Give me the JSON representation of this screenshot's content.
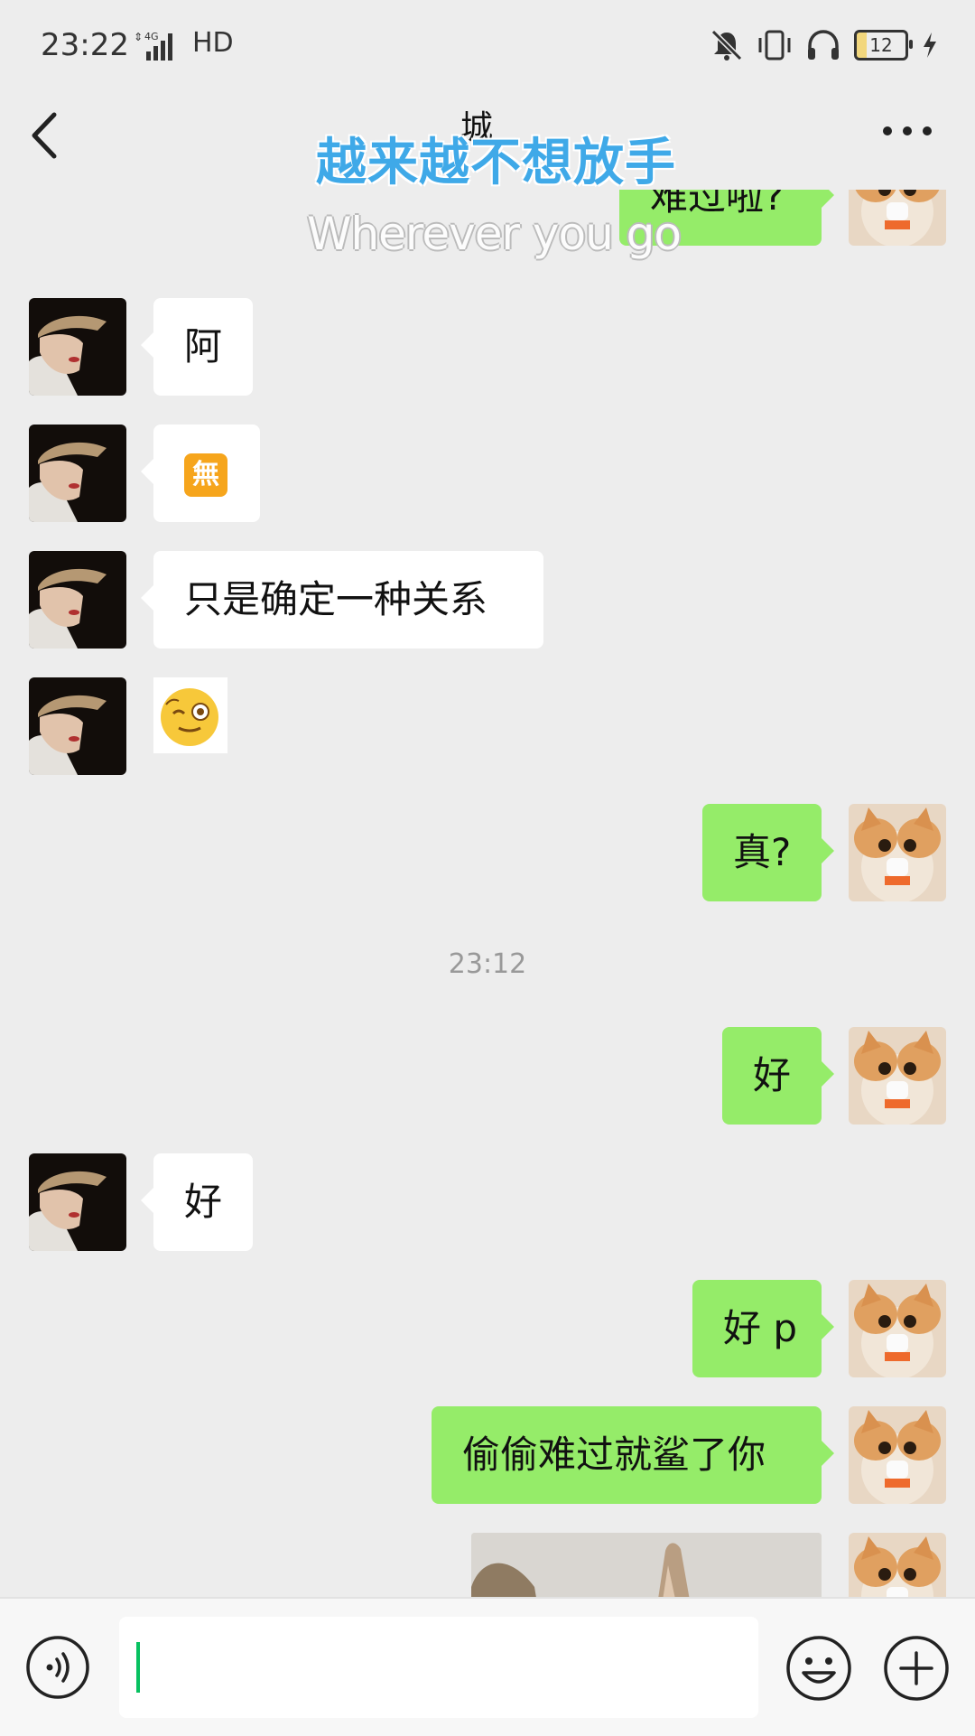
{
  "status_bar": {
    "time": "23:22",
    "network": "4G",
    "hd": "HD",
    "battery": "12"
  },
  "nav": {
    "title": "城"
  },
  "overlay": {
    "title": "越来越不想放手",
    "subtitle": "Wherever you go"
  },
  "messages": {
    "m1": "难过啦?",
    "m2": "阿",
    "m3_sticker": "無",
    "m4": "只是确定一种关系",
    "m6": "真?",
    "timestamp": "23:12",
    "m7": "好",
    "m8": "好",
    "m9": "好 p",
    "m10": "偷偷难过就鲨了你"
  },
  "icons": {
    "back": "back-arrow-icon",
    "more": "more-dots-icon",
    "voice": "voice-icon",
    "emoji": "emoji-icon",
    "plus": "plus-icon",
    "mute": "bell-muted-icon",
    "vibrate": "vibrate-icon",
    "headphones": "headphones-icon",
    "charging": "lightning-icon"
  },
  "colors": {
    "background": "#ededed",
    "outgoing_bubble": "#95ec69",
    "incoming_bubble": "#ffffff",
    "overlay_title": "#3fa9e8",
    "caret": "#07c160"
  }
}
